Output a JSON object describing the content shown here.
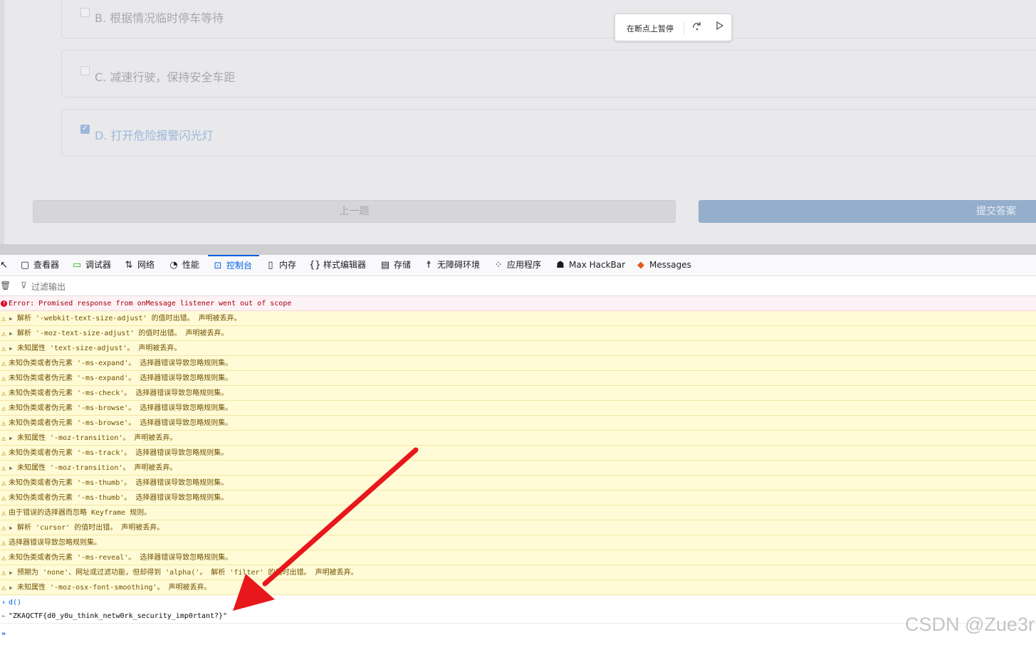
{
  "page": {
    "options": [
      {
        "label": "B. 根据情况临时停车等待",
        "checked": false
      },
      {
        "label": "C. 减速行驶，保持安全车距",
        "checked": false
      },
      {
        "label": "D. 打开危险报警闪光灯",
        "checked": true
      }
    ],
    "prev_button": "上一题",
    "submit_button": "提交答案"
  },
  "debugger_pill": {
    "label": "在断点上暂停",
    "step_icon": "step-over-icon",
    "resume_icon": "resume-icon"
  },
  "devtools": {
    "tabs": [
      {
        "label": "查看器",
        "icon": "inspector-icon"
      },
      {
        "label": "调试器",
        "icon": "debugger-icon"
      },
      {
        "label": "网络",
        "icon": "network-icon"
      },
      {
        "label": "性能",
        "icon": "performance-icon"
      },
      {
        "label": "控制台",
        "icon": "console-icon",
        "active": true
      },
      {
        "label": "内存",
        "icon": "memory-icon"
      },
      {
        "label": "样式编辑器",
        "icon": "style-editor-icon"
      },
      {
        "label": "存储",
        "icon": "storage-icon"
      },
      {
        "label": "无障碍环境",
        "icon": "accessibility-icon"
      },
      {
        "label": "应用程序",
        "icon": "application-icon"
      },
      {
        "label": "Max HackBar",
        "icon": "hackbar-icon"
      },
      {
        "label": "Messages",
        "icon": "fox-icon"
      }
    ],
    "filter_placeholder": "过滤输出"
  },
  "console": {
    "messages": [
      {
        "level": "error",
        "twisty": false,
        "text": "Error: Promised response from onMessage listener went out of scope"
      },
      {
        "level": "warning",
        "twisty": true,
        "text": "解析 '-webkit-text-size-adjust' 的值时出错。  声明被丢弃。"
      },
      {
        "level": "warning",
        "twisty": true,
        "text": "解析 '-moz-text-size-adjust' 的值时出错。  声明被丢弃。"
      },
      {
        "level": "warning",
        "twisty": true,
        "text": "未知属性 'text-size-adjust'。  声明被丢弃。"
      },
      {
        "level": "warning",
        "twisty": false,
        "text": "未知伪类或者伪元素 '-ms-expand'。  选择器错误导致忽略规则集。"
      },
      {
        "level": "warning",
        "twisty": false,
        "text": "未知伪类或者伪元素 '-ms-expand'。  选择器错误导致忽略规则集。"
      },
      {
        "level": "warning",
        "twisty": false,
        "text": "未知伪类或者伪元素 '-ms-check'。  选择器错误导致忽略规则集。"
      },
      {
        "level": "warning",
        "twisty": false,
        "text": "未知伪类或者伪元素 '-ms-browse'。  选择器错误导致忽略规则集。"
      },
      {
        "level": "warning",
        "twisty": false,
        "text": "未知伪类或者伪元素 '-ms-browse'。  选择器错误导致忽略规则集。"
      },
      {
        "level": "warning",
        "twisty": true,
        "text": "未知属性 '-moz-transition'。  声明被丢弃。"
      },
      {
        "level": "warning",
        "twisty": false,
        "text": "未知伪类或者伪元素 '-ms-track'。  选择器错误导致忽略规则集。"
      },
      {
        "level": "warning",
        "twisty": true,
        "text": "未知属性 '-moz-transition'。  声明被丢弃。"
      },
      {
        "level": "warning",
        "twisty": false,
        "text": "未知伪类或者伪元素 '-ms-thumb'。  选择器错误导致忽略规则集。"
      },
      {
        "level": "warning",
        "twisty": false,
        "text": "未知伪类或者伪元素 '-ms-thumb'。  选择器错误导致忽略规则集。"
      },
      {
        "level": "warning",
        "twisty": false,
        "text": "由于错误的选择器而忽略 Keyframe 规则。"
      },
      {
        "level": "warning",
        "twisty": true,
        "text": "解析 'cursor' 的值时出错。  声明被丢弃。"
      },
      {
        "level": "warning",
        "twisty": false,
        "text": "选择器错误导致忽略规则集。"
      },
      {
        "level": "warning",
        "twisty": false,
        "text": "未知伪类或者伪元素 '-ms-reveal'。  选择器错误导致忽略规则集。"
      },
      {
        "level": "warning",
        "twisty": true,
        "text": "预期为 'none'、网址或过滤功能，但却得到 'alpha('。  解析 'filter' 的值时出错。  声明被丢弃。"
      },
      {
        "level": "warning",
        "twisty": true,
        "text": "未知属性 '-moz-osx-font-smoothing'。  声明被丢弃。"
      }
    ],
    "input_command": "d()",
    "output_value": "\"ZKAQCTF{d0_y0u_think_netw0rk_security_imp0rtant?}\"",
    "prompt": "»"
  },
  "annotation": {
    "arrow_color": "#e8171c"
  },
  "watermark": "CSDN @Zue3r"
}
